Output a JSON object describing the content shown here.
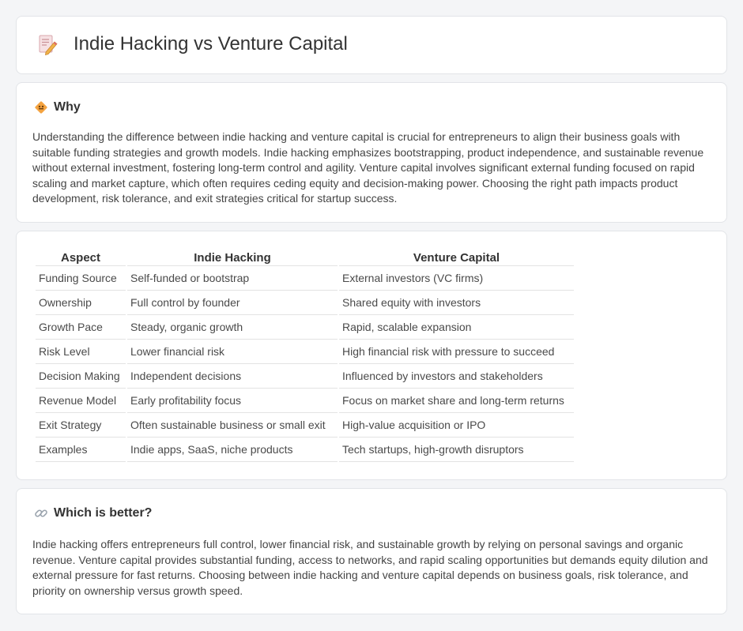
{
  "header": {
    "title": "Indie Hacking vs Venture Capital",
    "icon": "document-pencil-icon"
  },
  "why": {
    "icon": "diamond-sign-icon",
    "title": "Why",
    "text": "Understanding the difference between indie hacking and venture capital is crucial for entrepreneurs to align their business goals with suitable funding strategies and growth models. Indie hacking emphasizes bootstrapping, product independence, and sustainable revenue without external investment, fostering long-term control and agility. Venture capital involves significant external funding focused on rapid scaling and market capture, which often requires ceding equity and decision-making power. Choosing the right path impacts product development, risk tolerance, and exit strategies critical for startup success."
  },
  "comparison": {
    "headers": [
      "Aspect",
      "Indie Hacking",
      "Venture Capital"
    ],
    "rows": [
      [
        "Funding Source",
        "Self-funded or bootstrap",
        "External investors (VC firms)"
      ],
      [
        "Ownership",
        "Full control by founder",
        "Shared equity with investors"
      ],
      [
        "Growth Pace",
        "Steady, organic growth",
        "Rapid, scalable expansion"
      ],
      [
        "Risk Level",
        "Lower financial risk",
        "High financial risk with pressure to succeed"
      ],
      [
        "Decision Making",
        "Independent decisions",
        "Influenced by investors and stakeholders"
      ],
      [
        "Revenue Model",
        "Early profitability focus",
        "Focus on market share and long-term returns"
      ],
      [
        "Exit Strategy",
        "Often sustainable business or small exit",
        "High-value acquisition or IPO"
      ],
      [
        "Examples",
        "Indie apps, SaaS, niche products",
        "Tech startups, high-growth disruptors"
      ]
    ]
  },
  "better": {
    "icon": "link-icon",
    "title": "Which is better?",
    "text": "Indie hacking offers entrepreneurs full control, lower financial risk, and sustainable growth by relying on personal savings and organic revenue. Venture capital provides substantial funding, access to networks, and rapid scaling opportunities but demands equity dilution and external pressure for fast returns. Choosing between indie hacking and venture capital depends on business goals, risk tolerance, and priority on ownership versus growth speed."
  },
  "colors": {
    "background": "#f4f5f7",
    "card": "#ffffff",
    "border": "#e2e4e8",
    "icon_orange": "#f4a340"
  }
}
